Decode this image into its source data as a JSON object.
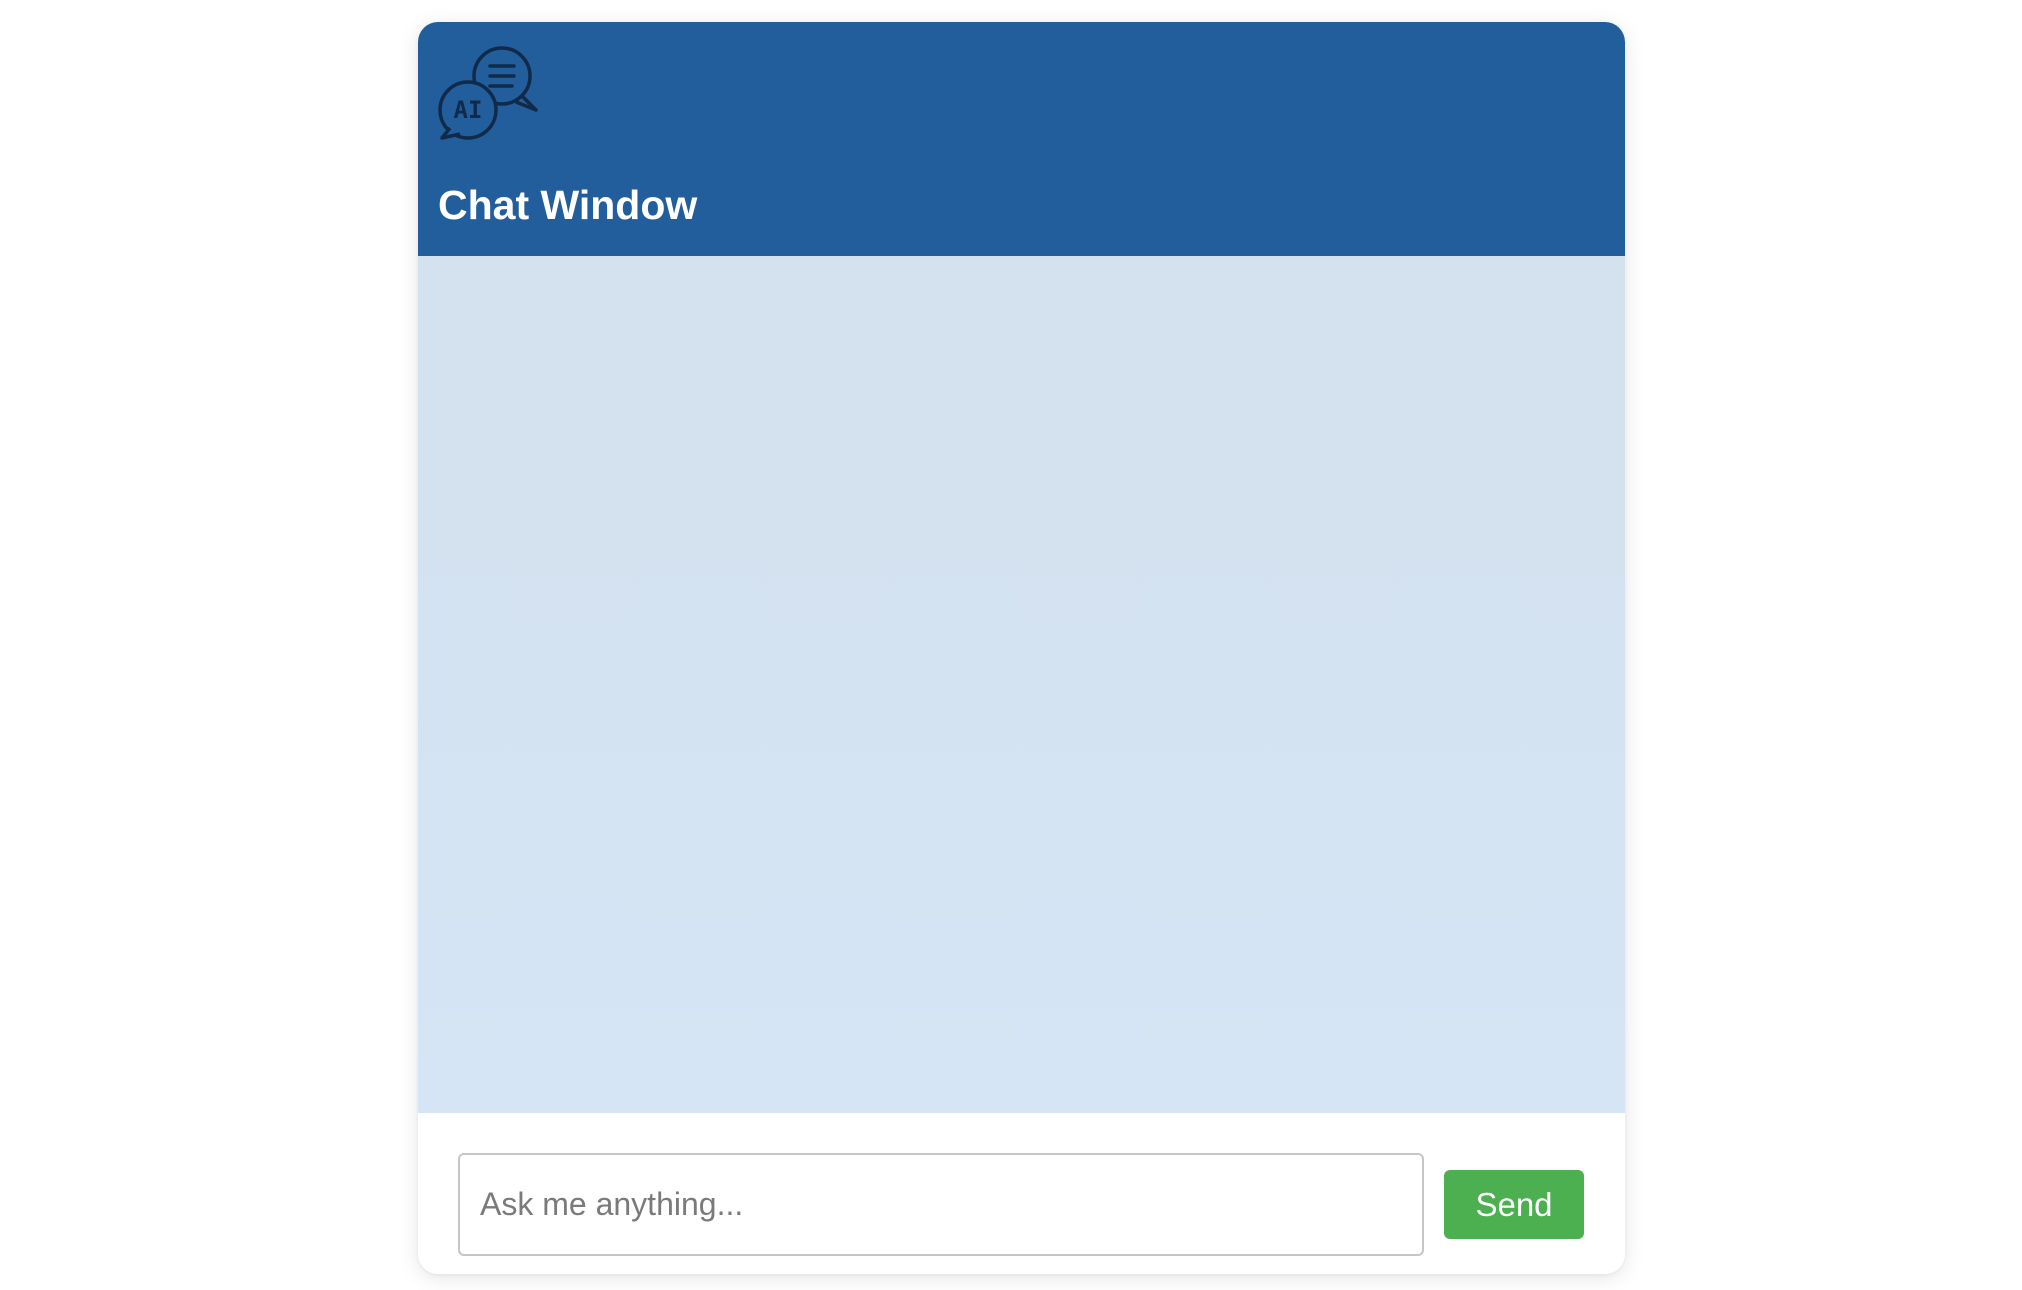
{
  "header": {
    "logo_icon": "ai-chat-bubbles-icon",
    "logo_text": "AI",
    "title": "Chat Window"
  },
  "messages": [],
  "composer": {
    "placeholder": "Ask me anything...",
    "value": "",
    "send_label": "Send"
  },
  "colors": {
    "header": "#235e9c",
    "messages_bg": "#d5e3f1",
    "send_button": "#4caf50"
  }
}
